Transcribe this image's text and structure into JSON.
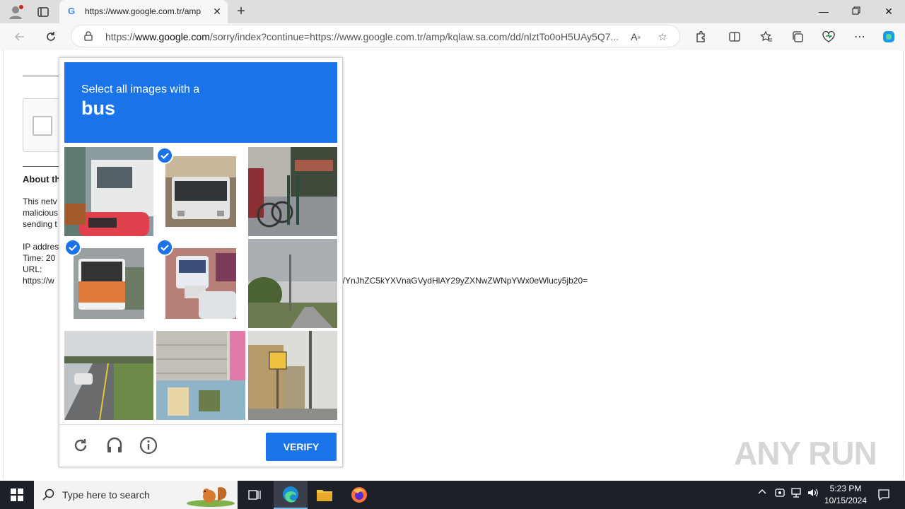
{
  "browser": {
    "tab_title": "https://www.google.com.tr/amp",
    "url_prefix": "https://",
    "url_domain": "www.google.com",
    "url_rest": "/sorry/index?continue=https://www.google.com.tr/amp/kqlaw.sa.com/dd/nlztTo0oH5UAy5Q7..."
  },
  "background_page": {
    "about_heading": "About th",
    "line1": "This netv",
    "line2": "malicious",
    "line3": "sending t",
    "ip_label": "IP addres",
    "time_label": "Time: 20",
    "url_label": "URL:",
    "url_value": "https://w",
    "url_tail": "1/YnJhZC5kYXVnaGVydHlAY29yZXNwZWNpYWx0eWlucy5jb20="
  },
  "captcha": {
    "prompt_line1": "Select all images with a",
    "target_word": "bus",
    "verify_label": "VERIFY",
    "tiles": [
      {
        "label": "truck and red car",
        "selected": false
      },
      {
        "label": "bus front",
        "selected": true
      },
      {
        "label": "bicycle by railing",
        "selected": false
      },
      {
        "label": "orange and white bus rear",
        "selected": true
      },
      {
        "label": "white bus in traffic",
        "selected": true
      },
      {
        "label": "road with trees",
        "selected": false
      },
      {
        "label": "car on rural road",
        "selected": false
      },
      {
        "label": "building with scaffolding",
        "selected": false
      },
      {
        "label": "street sign and trees",
        "selected": false
      }
    ]
  },
  "watermark": "ANY RUN",
  "taskbar": {
    "search_placeholder": "Type here to search",
    "time": "5:23 PM",
    "date": "10/15/2024"
  },
  "colors": {
    "accent": "#1a73e8",
    "taskbar": "#1c2029"
  }
}
